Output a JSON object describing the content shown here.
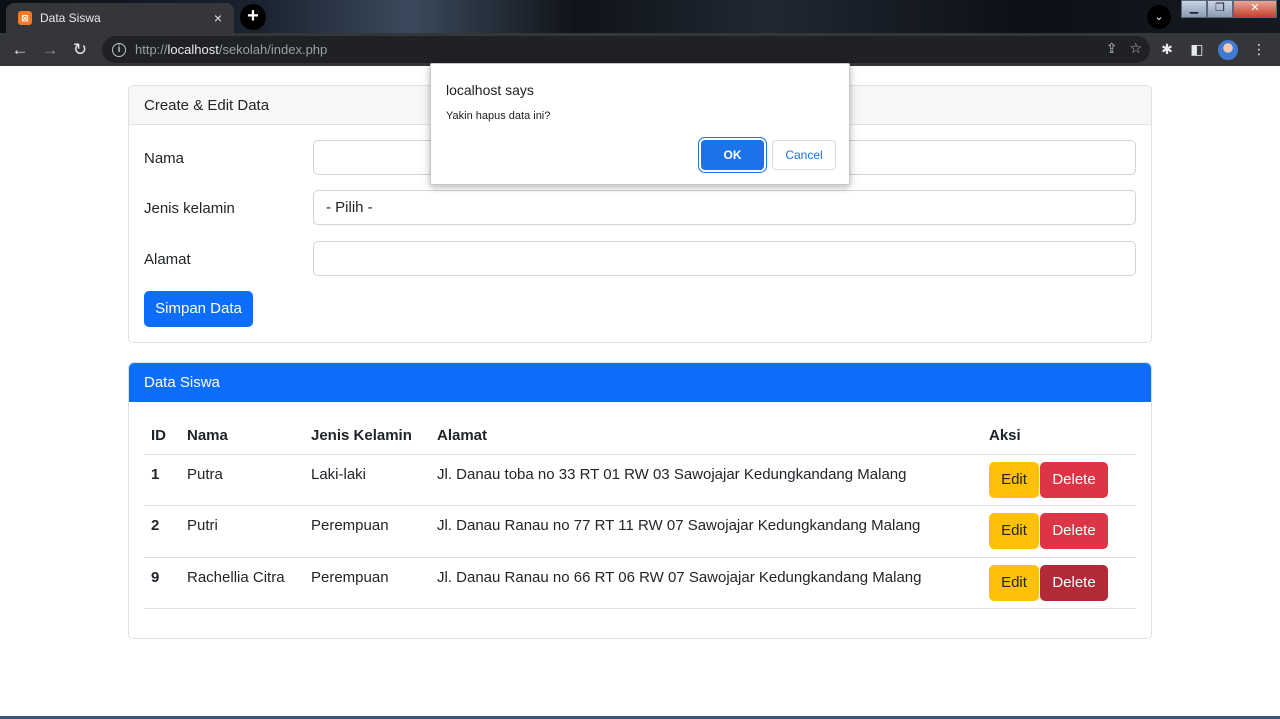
{
  "browser": {
    "tab_title": "Data Siswa",
    "tab_close": "×",
    "new_tab": "+",
    "url_prefix": "http://",
    "url_host": "localhost",
    "url_path": "/sekolah/index.php"
  },
  "form": {
    "header": "Create & Edit Data",
    "nama_label": "Nama",
    "nama_value": "",
    "jk_label": "Jenis kelamin",
    "jk_selected": "- Pilih -",
    "alamat_label": "Alamat",
    "alamat_value": "",
    "submit_label": "Simpan Data"
  },
  "table": {
    "header": "Data Siswa",
    "columns": [
      "ID",
      "Nama",
      "Jenis Kelamin",
      "Alamat",
      "Aksi"
    ],
    "rows": [
      {
        "id": "1",
        "nama": "Putra",
        "jk": "Laki-laki",
        "alamat": "Jl. Danau toba no 33 RT 01 RW 03 Sawojajar Kedungkandang Malang"
      },
      {
        "id": "2",
        "nama": "Putri",
        "jk": "Perempuan",
        "alamat": "Jl. Danau Ranau no 77 RT 11 RW 07 Sawojajar Kedungkandang Malang"
      },
      {
        "id": "9",
        "nama": "Rachellia Citra",
        "jk": "Perempuan",
        "alamat": "Jl. Danau Ranau no 66 RT 06 RW 07 Sawojajar Kedungkandang Malang"
      }
    ],
    "edit_label": "Edit",
    "delete_label": "Delete"
  },
  "dialog": {
    "title": "localhost says",
    "message": "Yakin hapus data ini?",
    "ok_label": "OK",
    "cancel_label": "Cancel"
  },
  "colors": {
    "primary": "#0d6efd",
    "warning": "#ffc107",
    "danger": "#dc3545",
    "danger_active": "#b02a37",
    "dialog_ok": "#1a73e8"
  }
}
